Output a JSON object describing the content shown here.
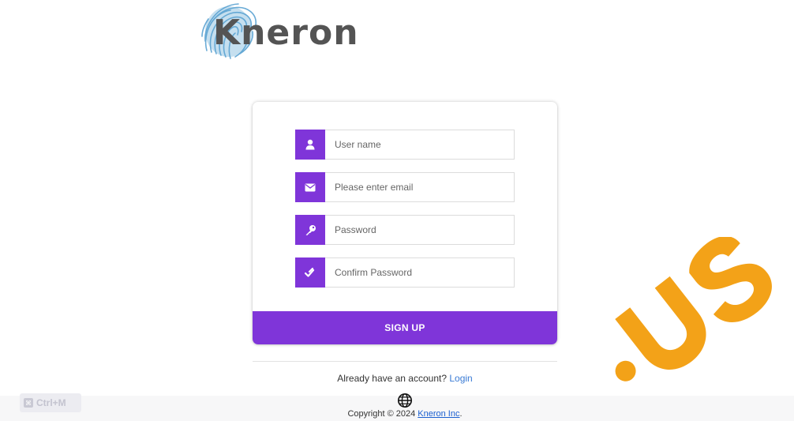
{
  "logo": {
    "text": "Kneron"
  },
  "form": {
    "username_placeholder": "User name",
    "email_placeholder": "Please enter email",
    "password_placeholder": "Password",
    "confirm_password_placeholder": "Confirm Password",
    "submit_label": "SIGN UP"
  },
  "login_prompt": {
    "text": "Already have an account? ",
    "link_label": "Login"
  },
  "footer": {
    "copyright_text": "Copyright © 2024 ",
    "company_link": "Kneron Inc",
    "trailing": "."
  },
  "shortcut": {
    "label": "Ctrl+M"
  },
  "colors": {
    "accent": "#7f35d9",
    "link": "#3a7bd5",
    "watermark": "#f29800"
  },
  "icons": {
    "username": "user-icon",
    "email": "envelope-icon",
    "password": "key-icon",
    "confirm_password": "double-check-icon",
    "language": "globe-icon"
  }
}
